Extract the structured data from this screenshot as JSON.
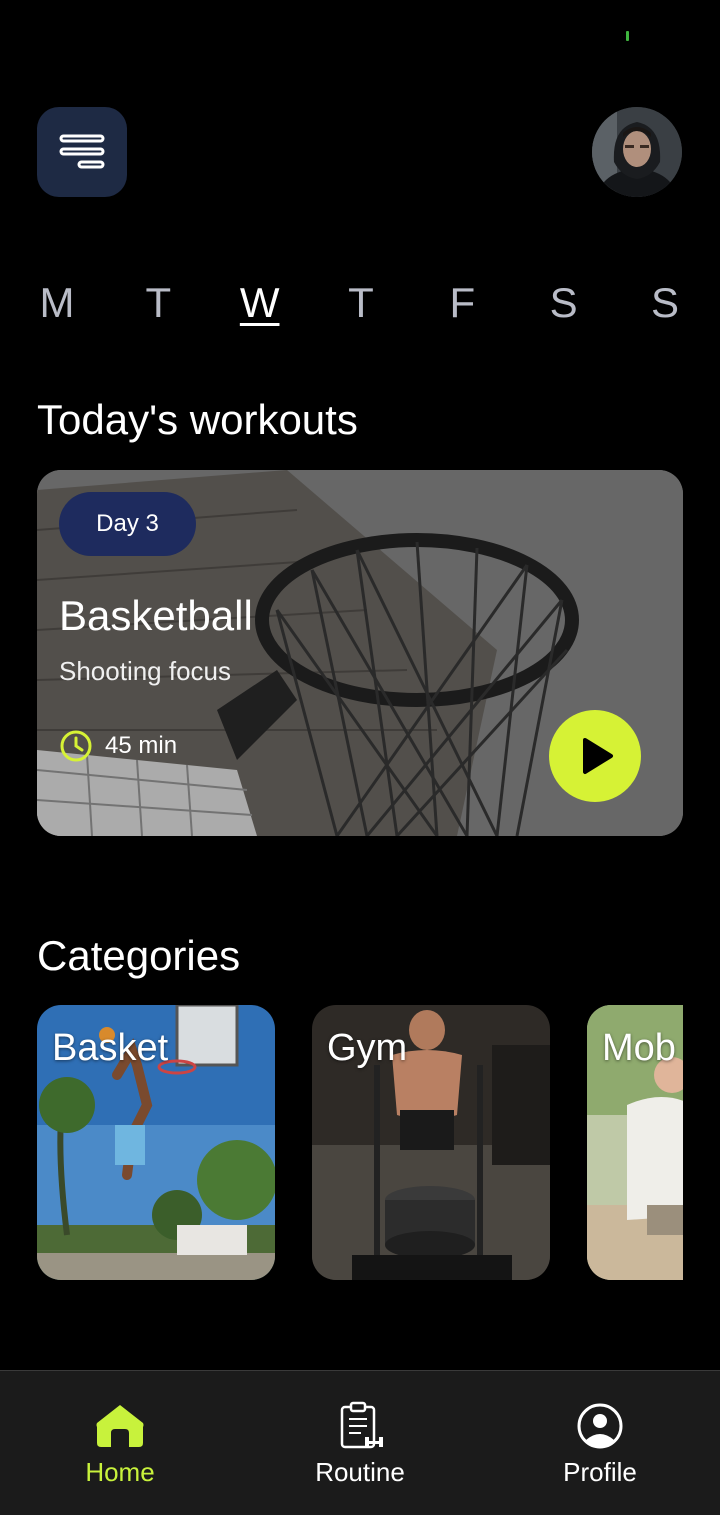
{
  "header": {
    "menu_icon": "menu-icon",
    "avatar_icon": "avatar"
  },
  "days": {
    "items": [
      "M",
      "T",
      "W",
      "T",
      "F",
      "S",
      "S"
    ],
    "selected": "W"
  },
  "today": {
    "section_title": "Today's workouts",
    "card": {
      "badge": "Day 3",
      "title": "Basketball",
      "subtitle": "Shooting focus",
      "duration": "45 min",
      "play_icon": "play-icon"
    }
  },
  "categories": {
    "section_title": "Categories",
    "items": [
      {
        "label": "Basket"
      },
      {
        "label": "Gym"
      },
      {
        "label": "Mob"
      }
    ]
  },
  "bottom_nav": {
    "items": [
      {
        "label": "Home",
        "icon": "home-icon",
        "active": true
      },
      {
        "label": "Routine",
        "icon": "clipboard-icon",
        "active": false
      },
      {
        "label": "Profile",
        "icon": "profile-icon",
        "active": false
      }
    ]
  },
  "colors": {
    "accent": "#d6f235",
    "nav_active": "#c8f23c",
    "badge_bg": "#1e2b5e",
    "menu_btn_bg": "#1e2a44"
  }
}
